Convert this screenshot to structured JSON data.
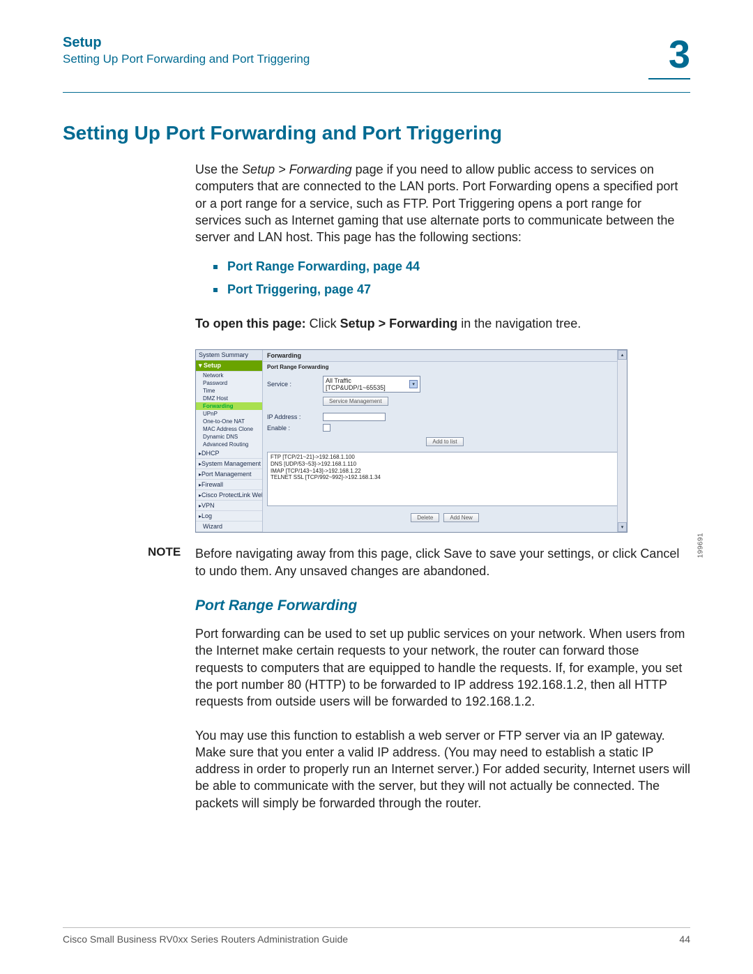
{
  "header": {
    "category": "Setup",
    "breadcrumb": "Setting Up Port Forwarding and Port Triggering",
    "chapter_number": "3"
  },
  "title": "Setting Up Port Forwarding and Port Triggering",
  "intro": {
    "pre": "Use the ",
    "path_italic": "Setup > Forwarding",
    "post": " page if you need to allow public access to services on computers that are connected to the LAN ports. Port Forwarding opens a specified port or a port range for a service, such as FTP. Port Triggering opens a port range for services such as Internet gaming that use alternate ports to communicate between the server and LAN host. This page has the following sections:"
  },
  "links": [
    "Port Range Forwarding, page 44",
    "Port Triggering, page 47"
  ],
  "open_line": {
    "label": "To open this page:",
    "verb": " Click ",
    "path": "Setup > Forwarding",
    "tail": " in the navigation tree."
  },
  "screenshot": {
    "sidebar": {
      "summary": "System Summary",
      "setup_group": "Setup",
      "items": [
        "Network",
        "Password",
        "Time",
        "DMZ Host",
        "Forwarding",
        "UPnP",
        "One-to-One NAT",
        "MAC Address Clone",
        "Dynamic DNS",
        "Advanced Routing"
      ],
      "collapsed": [
        "DHCP",
        "System Management",
        "Port Management",
        "Firewall",
        "Cisco ProtectLink Web",
        "VPN",
        "Log",
        "Wizard"
      ]
    },
    "panel": {
      "title": "Forwarding",
      "subtitle": "Port Range Forwarding",
      "service_label": "Service :",
      "service_value": "All Traffic [TCP&UDP/1~65535]",
      "service_mgmt": "Service Management",
      "ip_label": "IP Address :",
      "enable_label": "Enable :",
      "add_to_list": "Add to list",
      "entries": [
        "FTP [TCP/21~21]->192.168.1.100",
        "DNS [UDP/53~53]->192.168.1.110",
        "IMAP [TCP/143~143]->192.168.1.22",
        "TELNET SSL [TCP/992~992]->192.168.1.34"
      ],
      "delete_btn": "Delete",
      "addnew_btn": "Add New"
    },
    "image_id": "199691"
  },
  "note": {
    "label": "NOTE",
    "pre": "Before navigating away from this page, click ",
    "save": "Save",
    "mid": " to save your settings, or click ",
    "cancel": "Cancel",
    "post": " to undo them. Any unsaved changes are abandoned."
  },
  "subheading": "Port Range Forwarding",
  "para2": "Port forwarding can be used to set up public services on your network. When users from the Internet make certain requests to your network, the router can forward those requests to computers that are equipped to handle the requests. If, for example, you set the port number 80 (HTTP) to be forwarded to IP address 192.168.1.2, then all HTTP requests from outside users will be forwarded to 192.168.1.2.",
  "para3": "You may use this function to establish a web server or FTP server via an IP gateway. Make sure that you enter a valid IP address. (You may need to establish a static IP address in order to properly run an Internet server.) For added security, Internet users will be able to communicate with the server, but they will not actually be connected. The packets will simply be forwarded through the router.",
  "footer": {
    "book": "Cisco Small Business RV0xx Series Routers Administration Guide",
    "page": "44"
  }
}
